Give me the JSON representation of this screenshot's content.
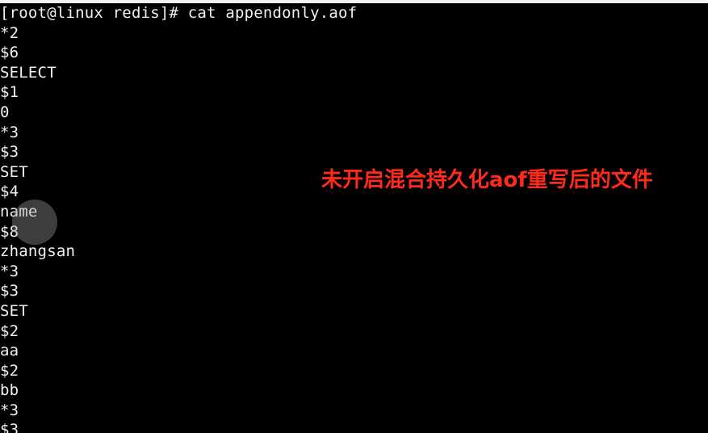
{
  "terminal": {
    "prompt": "[root@linux redis]# ",
    "command": "cat appendonly.aof",
    "output_lines": [
      "*2",
      "$6",
      "SELECT",
      "$1",
      "0",
      "*3",
      "$3",
      "SET",
      "$4",
      "name",
      "$8",
      "zhangsan",
      "*3",
      "$3",
      "SET",
      "$2",
      "aa",
      "$2",
      "bb",
      "*3",
      "$3"
    ]
  },
  "annotation": {
    "text": "未开启混合持久化aof重写后的文件"
  },
  "colors": {
    "background": "#000000",
    "foreground": "#f0f0f0",
    "annotation": "#ff2a1a"
  },
  "icons": {
    "cursor": "cursor-highlight-icon"
  }
}
